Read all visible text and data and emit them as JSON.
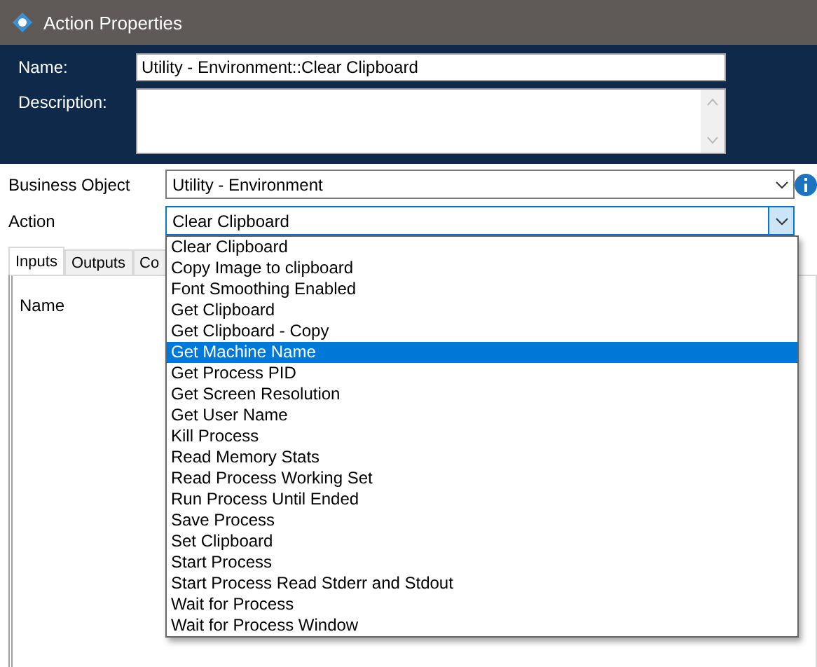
{
  "window": {
    "title": "Action Properties"
  },
  "header": {
    "name_label": "Name:",
    "name_value": "Utility - Environment::Clear Clipboard",
    "description_label": "Description:"
  },
  "business_object": {
    "label": "Business Object",
    "value": "Utility - Environment"
  },
  "action": {
    "label": "Action",
    "value": "Clear Clipboard",
    "expanded": true,
    "options": [
      {
        "label": "Clear Clipboard",
        "highlighted": false
      },
      {
        "label": "Copy Image to clipboard",
        "highlighted": false
      },
      {
        "label": "Font Smoothing Enabled",
        "highlighted": false
      },
      {
        "label": "Get Clipboard",
        "highlighted": false
      },
      {
        "label": "Get Clipboard - Copy",
        "highlighted": false
      },
      {
        "label": "Get Machine Name",
        "highlighted": true
      },
      {
        "label": "Get Process PID",
        "highlighted": false
      },
      {
        "label": "Get Screen Resolution",
        "highlighted": false
      },
      {
        "label": "Get User Name",
        "highlighted": false
      },
      {
        "label": "Kill Process",
        "highlighted": false
      },
      {
        "label": "Read Memory Stats",
        "highlighted": false
      },
      {
        "label": "Read Process Working Set",
        "highlighted": false
      },
      {
        "label": "Run Process Until Ended",
        "highlighted": false
      },
      {
        "label": "Save Process",
        "highlighted": false
      },
      {
        "label": "Set Clipboard",
        "highlighted": false
      },
      {
        "label": "Start Process",
        "highlighted": false
      },
      {
        "label": "Start Process Read Stderr and Stdout",
        "highlighted": false
      },
      {
        "label": "Wait for Process",
        "highlighted": false
      },
      {
        "label": "Wait for Process Window",
        "highlighted": false
      }
    ]
  },
  "tabs": [
    {
      "label": "Inputs",
      "selected": true
    },
    {
      "label": "Outputs",
      "selected": false
    },
    {
      "label": "Co",
      "selected": false
    }
  ],
  "table": {
    "columns": [
      "Name"
    ]
  }
}
